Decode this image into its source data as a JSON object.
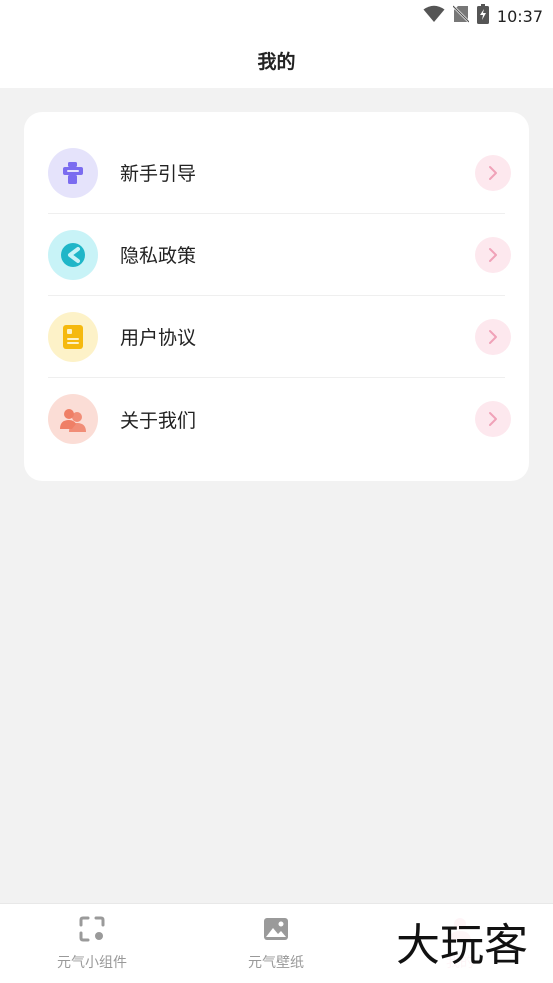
{
  "status_bar": {
    "time": "10:37",
    "icons": [
      "wifi-icon",
      "no-sim-icon",
      "battery-charging-icon"
    ]
  },
  "header": {
    "title": "我的"
  },
  "menu": {
    "items": [
      {
        "label": "新手引导",
        "icon": "guide-icon",
        "icon_bg": "#e5e3fb",
        "icon_color": "#7b6cf0"
      },
      {
        "label": "隐私政策",
        "icon": "privacy-icon",
        "icon_bg": "#c8f3f7",
        "icon_color": "#1fb6c8"
      },
      {
        "label": "用户协议",
        "icon": "agreement-icon",
        "icon_bg": "#fdf2c8",
        "icon_color": "#f5b90f"
      },
      {
        "label": "关于我们",
        "icon": "about-us-icon",
        "icon_bg": "#fbddd6",
        "icon_color": "#ef7f66"
      }
    ],
    "chevron_color": "#f0a2b8"
  },
  "tab_bar": {
    "tabs": [
      {
        "label": "元气小组件",
        "icon": "widget-icon",
        "active": false
      },
      {
        "label": "元气壁纸",
        "icon": "wallpaper-icon",
        "active": false
      },
      {
        "label": "我的",
        "icon": "profile-icon",
        "active": true
      }
    ],
    "active_color": "#f07a9a",
    "inactive_color": "#999999"
  },
  "watermark": {
    "text": "大玩客"
  }
}
